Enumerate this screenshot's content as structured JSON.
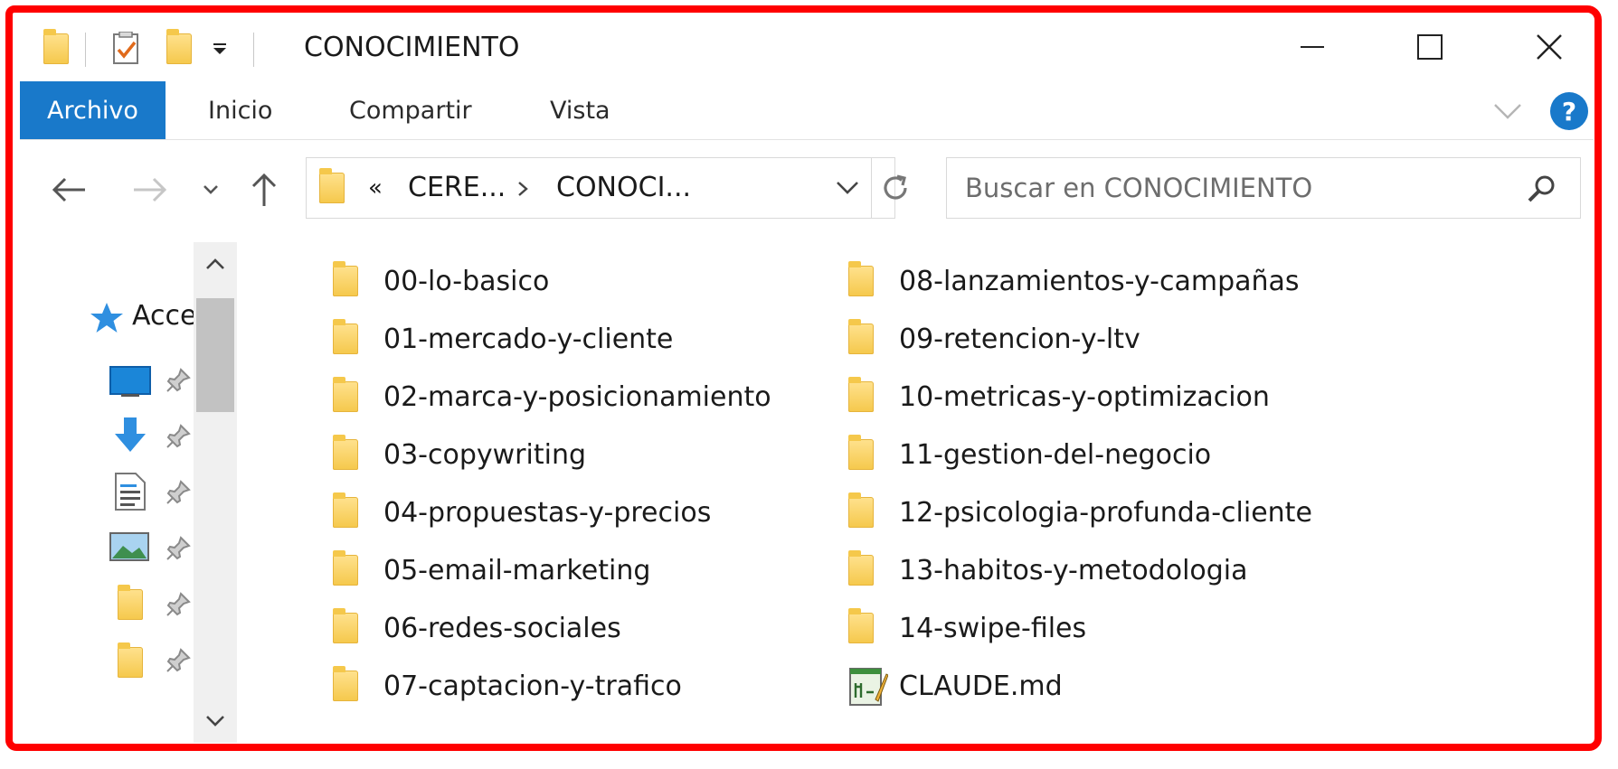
{
  "window": {
    "title": "CONOCIMIENTO"
  },
  "ribbon": {
    "tabs": [
      {
        "label": "Archivo",
        "active": true
      },
      {
        "label": "Inicio"
      },
      {
        "label": "Compartir"
      },
      {
        "label": "Vista"
      }
    ],
    "help_label": "?"
  },
  "address_bar": {
    "overflow_label": "«",
    "breadcrumb": [
      "CERE...",
      "CONOCI..."
    ],
    "separator": ">"
  },
  "search": {
    "placeholder": "Buscar en CONOCIMIENTO"
  },
  "nav_pane": {
    "quick_access_label": "Acce",
    "pinned": [
      {
        "icon": "desktop-icon"
      },
      {
        "icon": "downloads-icon"
      },
      {
        "icon": "documents-icon"
      },
      {
        "icon": "pictures-icon"
      },
      {
        "icon": "folder-icon"
      },
      {
        "icon": "folder-icon"
      }
    ]
  },
  "items": [
    {
      "name": "00-lo-basico",
      "type": "folder"
    },
    {
      "name": "01-mercado-y-cliente",
      "type": "folder"
    },
    {
      "name": "02-marca-y-posicionamiento",
      "type": "folder"
    },
    {
      "name": "03-copywriting",
      "type": "folder"
    },
    {
      "name": "04-propuestas-y-precios",
      "type": "folder"
    },
    {
      "name": "05-email-marketing",
      "type": "folder"
    },
    {
      "name": "06-redes-sociales",
      "type": "folder"
    },
    {
      "name": "07-captacion-y-trafico",
      "type": "folder"
    },
    {
      "name": "08-lanzamientos-y-campañas",
      "type": "folder"
    },
    {
      "name": "09-retencion-y-ltv",
      "type": "folder"
    },
    {
      "name": "10-metricas-y-optimizacion",
      "type": "folder"
    },
    {
      "name": "11-gestion-del-negocio",
      "type": "folder"
    },
    {
      "name": "12-psicologia-profunda-cliente",
      "type": "folder"
    },
    {
      "name": "13-habitos-y-metodologia",
      "type": "folder"
    },
    {
      "name": "14-swipe-files",
      "type": "folder"
    },
    {
      "name": "CLAUDE.md",
      "type": "file"
    }
  ],
  "colors": {
    "accent": "#1979ca",
    "annotation_frame": "#ff0000",
    "folder": "#f5c84b"
  }
}
